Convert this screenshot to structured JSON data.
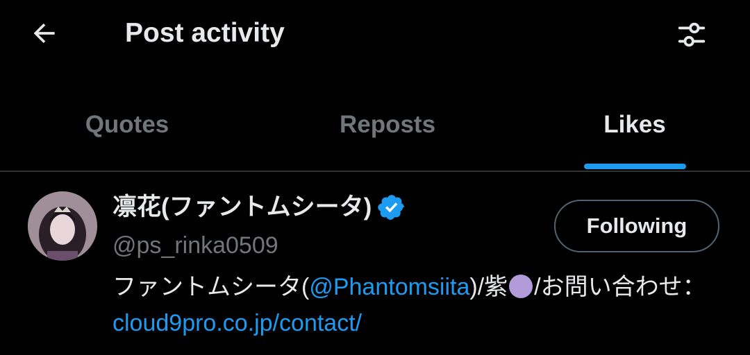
{
  "header": {
    "title": "Post activity",
    "back_icon": "arrow-left-icon",
    "filter_icon": "sliders-icon"
  },
  "tabs": [
    {
      "label": "Quotes",
      "active": false
    },
    {
      "label": "Reposts",
      "active": false
    },
    {
      "label": "Likes",
      "active": true
    }
  ],
  "user": {
    "display_name": "凛花(ファントムシータ)",
    "handle": "@ps_rinka0509",
    "verified": true,
    "follow_label": "Following",
    "bio": {
      "part1": "ファントムシータ(",
      "mention": "@Phantomsiita",
      "part2": ")/紫",
      "emoji_color": "#b19cd9",
      "part3": "/お問い合わせ：",
      "link": "cloud9pro.co.jp/contact/"
    }
  },
  "colors": {
    "background": "#000000",
    "text_primary": "#e7e9ea",
    "text_secondary": "#71767b",
    "accent": "#1d9bf0",
    "divider": "#2f3336"
  }
}
